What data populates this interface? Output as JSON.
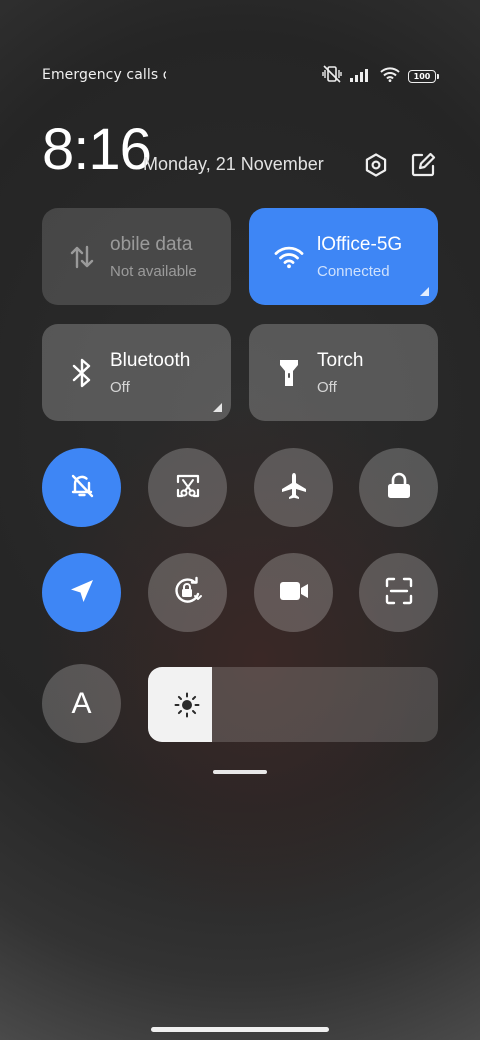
{
  "status_bar": {
    "carrier_text": "Emergency calls o",
    "battery_level": "100",
    "icons": [
      "vibrate-mute-icon",
      "signal-icon",
      "wifi-icon",
      "battery-icon"
    ]
  },
  "header": {
    "time": "8:16",
    "date": "Monday, 21 November",
    "icons": [
      "settings-icon",
      "edit-icon"
    ]
  },
  "tiles": [
    {
      "name": "obile data",
      "status": "Not available",
      "icon": "mobile-data-icon",
      "state": "disabled"
    },
    {
      "name": "lOffice-5G",
      "status": "Connected",
      "icon": "wifi-icon",
      "state": "active"
    },
    {
      "name": "Bluetooth",
      "status": "Off",
      "icon": "bluetooth-icon",
      "state": "off"
    },
    {
      "name": "Torch",
      "status": "Off",
      "icon": "torch-icon",
      "state": "off"
    }
  ],
  "toggles_row1": [
    {
      "icon": "mute-bell-icon",
      "state": "active"
    },
    {
      "icon": "screenshot-icon",
      "state": "off"
    },
    {
      "icon": "airplane-icon",
      "state": "off"
    },
    {
      "icon": "lock-icon",
      "state": "off"
    }
  ],
  "toggles_row2": [
    {
      "icon": "location-icon",
      "state": "active"
    },
    {
      "icon": "rotation-lock-icon",
      "state": "off"
    },
    {
      "icon": "video-camera-icon",
      "state": "off"
    },
    {
      "icon": "scanner-icon",
      "state": "off"
    }
  ],
  "font_button": {
    "label": "A",
    "icon": "font-size-icon"
  },
  "brightness": {
    "level": 0.22,
    "icon": "brightness-icon"
  },
  "colors": {
    "accent": "#3e86f5",
    "tile_bg": "rgba(255,255,255,0.22)"
  }
}
